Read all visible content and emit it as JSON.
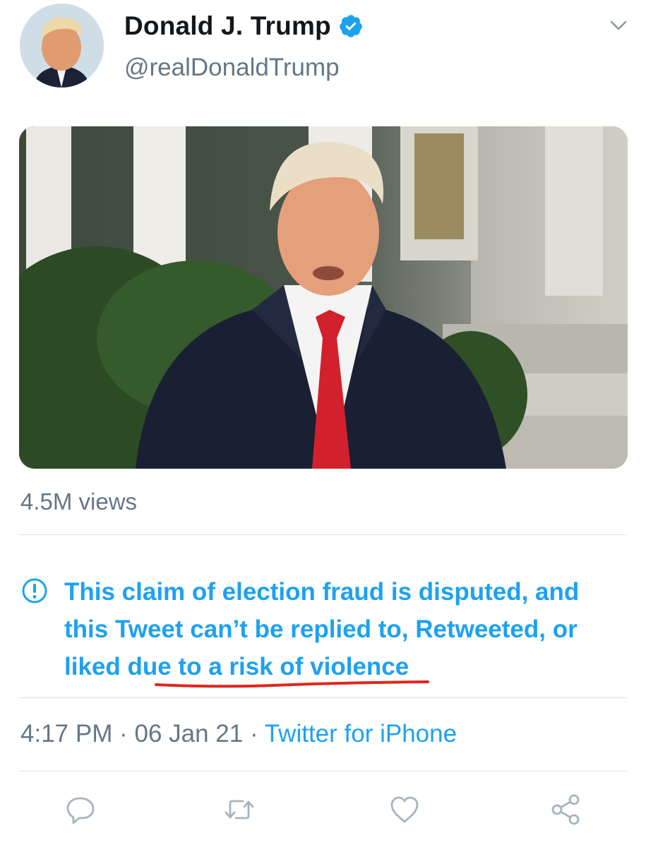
{
  "tweet": {
    "author_name": "Donald J. Trump",
    "author_handle": "@realDonaldTrump",
    "views": "4.5M views",
    "notice": "This claim of election fraud is disputed, and this Tweet can’t be replied to, Retweeted, or liked due to a risk of violence",
    "time": "4:17 PM",
    "separator": "·",
    "date": "06 Jan 21",
    "source": "Twitter for iPhone"
  },
  "icons": {
    "verified": "verified-badge-icon",
    "more": "chevron-down-icon",
    "notice": "exclamation-circle-icon",
    "reply": "reply-icon",
    "retweet": "retweet-icon",
    "like": "heart-icon",
    "share": "share-icon"
  },
  "colors": {
    "link_blue": "#1da1f2",
    "secondary_text": "#657786",
    "annotation_red": "#e0261e",
    "primary_text": "#14171a"
  }
}
